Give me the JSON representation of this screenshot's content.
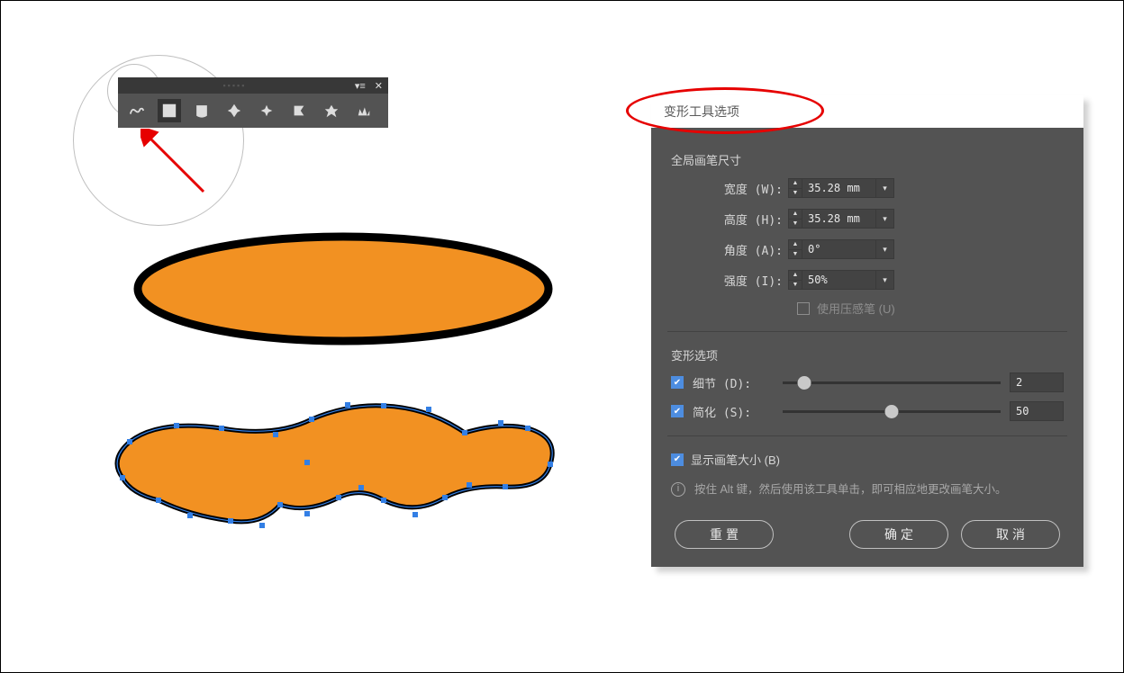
{
  "toolbar": {
    "tools": [
      {
        "name": "warp-tool-1"
      },
      {
        "name": "warp-tool-2",
        "active": true
      },
      {
        "name": "warp-tool-3"
      },
      {
        "name": "warp-tool-4"
      },
      {
        "name": "warp-tool-5"
      },
      {
        "name": "warp-tool-6"
      },
      {
        "name": "warp-tool-7"
      },
      {
        "name": "warp-tool-8"
      }
    ]
  },
  "dialog": {
    "title": "变形工具选项",
    "brushSection": "全局画笔尺寸",
    "width": {
      "label": "宽度 (W):",
      "value": "35.28 mm"
    },
    "height": {
      "label": "高度 (H):",
      "value": "35.28 mm"
    },
    "angle": {
      "label": "角度 (A):",
      "value": "0°"
    },
    "intensity": {
      "label": "强度 (I):",
      "value": "50%"
    },
    "pressurePen": {
      "label": "使用压感笔 (U)",
      "checked": false
    },
    "warpSection": "变形选项",
    "detail": {
      "label": "细节 (D):",
      "value": "2",
      "pos": 10,
      "checked": true
    },
    "simplify": {
      "label": "简化 (S):",
      "value": "50",
      "pos": 50,
      "checked": true
    },
    "showBrush": {
      "label": "显示画笔大小 (B)",
      "checked": true
    },
    "hint": "按住 Alt 键，然后使用该工具单击，即可相应地更改画笔大小。",
    "buttons": {
      "reset": "重置",
      "ok": "确定",
      "cancel": "取消"
    }
  },
  "colors": {
    "shapeFill": "#f29122",
    "shapeStroke": "#000000",
    "selectBlue": "#337fe5",
    "redAnn": "#e60000"
  }
}
